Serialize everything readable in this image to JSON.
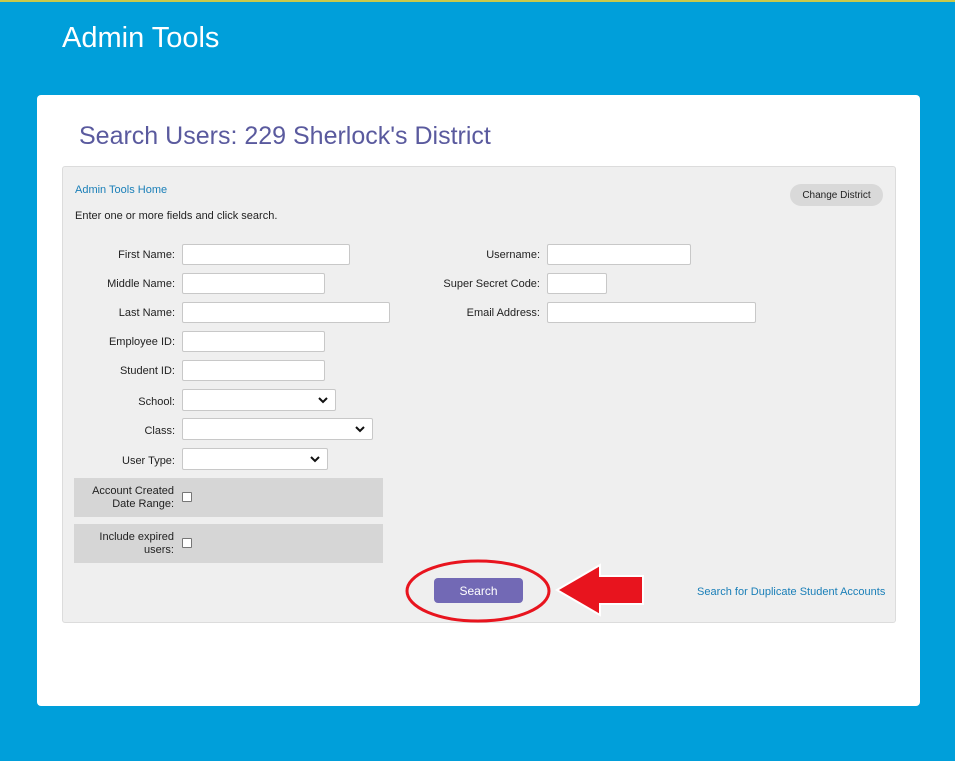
{
  "header": {
    "title": "Admin Tools"
  },
  "page": {
    "title": "Search Users: 229 Sherlock's District"
  },
  "panel": {
    "home_link": "Admin Tools Home",
    "instructions": "Enter one or more fields and click search.",
    "change_district_label": "Change District",
    "fields": {
      "first_name": {
        "label": "First Name:",
        "value": ""
      },
      "middle_name": {
        "label": "Middle Name:",
        "value": ""
      },
      "last_name": {
        "label": "Last Name:",
        "value": ""
      },
      "employee_id": {
        "label": "Employee ID:",
        "value": ""
      },
      "student_id": {
        "label": "Student ID:",
        "value": ""
      },
      "school": {
        "label": "School:",
        "selected": ""
      },
      "class": {
        "label": "Class:",
        "selected": ""
      },
      "user_type": {
        "label": "User Type:",
        "selected": ""
      },
      "account_created_line1": "Account Created",
      "account_created_line2": "Date Range:",
      "include_expired_line1": "Include expired",
      "include_expired_line2": "users:",
      "username": {
        "label": "Username:",
        "value": ""
      },
      "super_secret_code": {
        "label": "Super Secret Code:",
        "value": ""
      },
      "email": {
        "label": "Email Address:",
        "value": ""
      }
    },
    "search_label": "Search",
    "duplicate_link": "Search for Duplicate Student Accounts"
  },
  "annotation": {
    "highlight_color": "#e8141e"
  },
  "icons": {
    "select_arrow": "chevron-down-icon",
    "pointer": "red-arrow-annotation"
  }
}
